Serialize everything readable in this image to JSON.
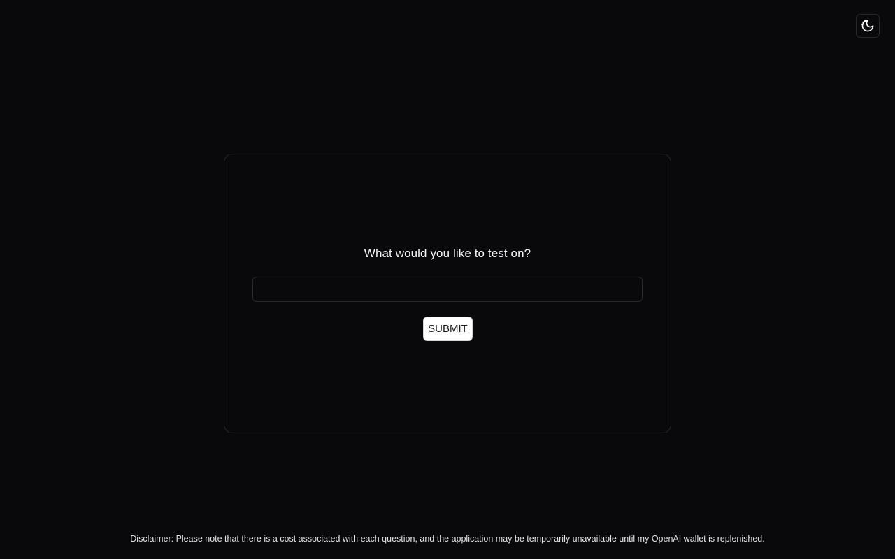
{
  "header": {
    "theme_toggle_icon": "moon-icon"
  },
  "card": {
    "question": "What would you like to test on?",
    "input_value": "",
    "input_placeholder": "",
    "submit_label": "SUBMIT"
  },
  "footer": {
    "disclaimer": "Disclaimer: Please note that there is a cost associated with each question, and the application may be temporarily unavailable until my OpenAI wallet is replenished."
  },
  "colors": {
    "background": "#09090b",
    "border": "#27272a",
    "button_bg": "#ffffff",
    "button_text": "#18181b",
    "text": "#fafafa"
  }
}
